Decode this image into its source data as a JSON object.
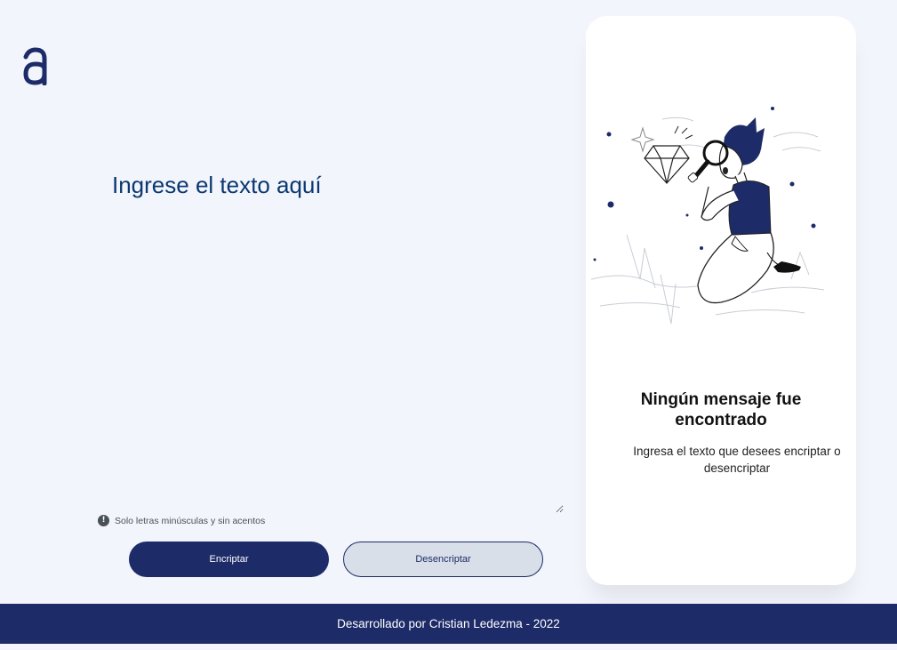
{
  "app": {
    "logo_icon": "letter-a-logo",
    "accent_color": "#1d2b68"
  },
  "editor": {
    "placeholder": "Ingrese el texto aquí",
    "value": ""
  },
  "hint": {
    "icon": "exclamation-circle-icon",
    "text": "Solo letras minúsculas y sin acentos"
  },
  "actions": {
    "encrypt_label": "Encriptar",
    "decrypt_label": "Desencriptar"
  },
  "output_panel": {
    "illustration": "person-with-magnifying-glass-illustration",
    "title": "Ningún mensaje fue encontrado",
    "subtitle": "Ingresa el texto que desees encriptar o desencriptar"
  },
  "footer": {
    "text": "Desarrollado por Cristian Ledezma - 2022"
  }
}
